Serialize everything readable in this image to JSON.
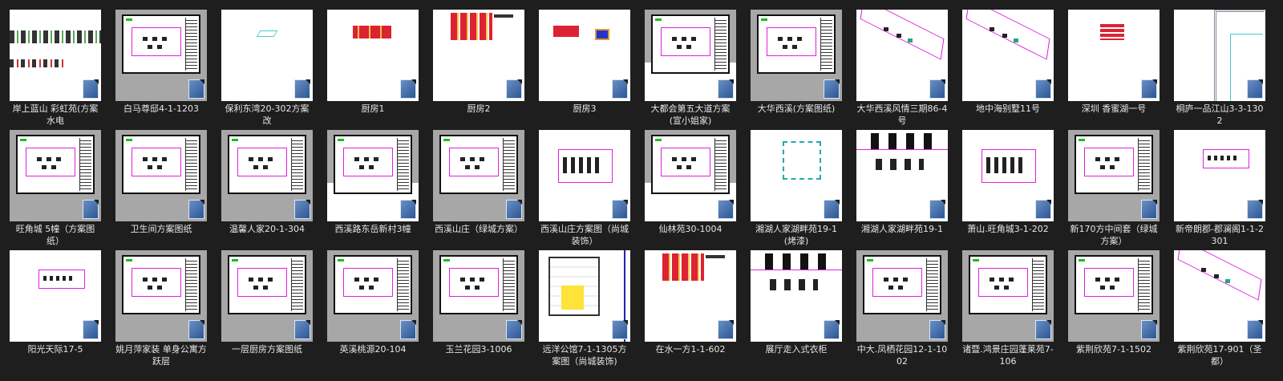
{
  "files": [
    {
      "name": "岸上蓝山 彩虹苑(方案水电",
      "thumb": "white",
      "art": "strip"
    },
    {
      "name": "白马尊邸4-1-1203",
      "thumb": "grey",
      "art": "sheet"
    },
    {
      "name": "保利东湾20-302方案改",
      "thumb": "white",
      "art": "cyan"
    },
    {
      "name": "厨房1",
      "thumb": "white",
      "art": "red-small"
    },
    {
      "name": "厨房2",
      "thumb": "white",
      "art": "red-large"
    },
    {
      "name": "厨房3",
      "thumb": "white",
      "art": "red-two"
    },
    {
      "name": "大都会第五大道方案(宣小姐家)",
      "thumb": "grey-top",
      "art": "sheet"
    },
    {
      "name": "大华西溪(方案图纸)",
      "thumb": "grey",
      "art": "sheet"
    },
    {
      "name": "大华西溪风情三期86-4号",
      "thumb": "white",
      "art": "iso"
    },
    {
      "name": "地中海别墅11号",
      "thumb": "white",
      "art": "iso"
    },
    {
      "name": "深圳 香蜜湖一号",
      "thumb": "white",
      "art": "red-one"
    },
    {
      "name": "桐庐一品江山3-3-1302",
      "thumb": "white",
      "art": "lines"
    },
    {
      "name": "旺角城 5幢（方案图纸）",
      "thumb": "grey",
      "art": "sheet"
    },
    {
      "name": "卫生间方案图纸",
      "thumb": "grey",
      "art": "sheet"
    },
    {
      "name": "温馨人家20-1-304",
      "thumb": "grey",
      "art": "sheet"
    },
    {
      "name": "西溪路东岳新村3幢",
      "thumb": "grey-top",
      "art": "sheet"
    },
    {
      "name": "西溪山庄（绿城方案）",
      "thumb": "grey",
      "art": "sheet"
    },
    {
      "name": "西溪山庄方案图（尚城装饰）",
      "thumb": "white",
      "art": "magframe"
    },
    {
      "name": "仙林苑30-1004",
      "thumb": "grey-top",
      "art": "sheet"
    },
    {
      "name": "湘湖人家湖畔苑19-1(烤漆)",
      "thumb": "white",
      "art": "cyanbox"
    },
    {
      "name": "湘湖人家湖畔苑19-1",
      "thumb": "white",
      "art": "furniture"
    },
    {
      "name": "萧山.旺角城3-1-202",
      "thumb": "white",
      "art": "magframe"
    },
    {
      "name": "新170方中间套（绿城方案）",
      "thumb": "grey",
      "art": "sheet"
    },
    {
      "name": "新帝朗郡-郡澜阁1-1-2301",
      "thumb": "white",
      "art": "magsmall"
    },
    {
      "name": "阳光天际17-5",
      "thumb": "white",
      "art": "magsmall"
    },
    {
      "name": "姚月萍家装 单身公寓方跃层",
      "thumb": "grey",
      "art": "sheet"
    },
    {
      "name": "一层厨房方案图纸",
      "thumb": "grey",
      "art": "sheet"
    },
    {
      "name": "英溪桃源20-104",
      "thumb": "grey",
      "art": "sheet"
    },
    {
      "name": "玉兰花园3-1006",
      "thumb": "grey",
      "art": "sheet"
    },
    {
      "name": "远洋公馆7-1-1305方案图（尚城装饰)",
      "thumb": "white",
      "art": "plan"
    },
    {
      "name": "在水一方1-1-602",
      "thumb": "white",
      "art": "red-large"
    },
    {
      "name": "展厅走入式衣柜",
      "thumb": "white",
      "art": "furniture"
    },
    {
      "name": "中大.凤栖花园12-1-1002",
      "thumb": "grey",
      "art": "sheet"
    },
    {
      "name": "诸暨.鸿景庄园蓬莱苑7-106",
      "thumb": "grey",
      "art": "sheet"
    },
    {
      "name": "紫荆欣苑7-1-1502",
      "thumb": "grey",
      "art": "sheet"
    },
    {
      "name": "紫荆欣苑17-901（圣都）",
      "thumb": "white",
      "art": "iso"
    }
  ],
  "icons": {
    "file_type": "dwg-file-icon"
  }
}
